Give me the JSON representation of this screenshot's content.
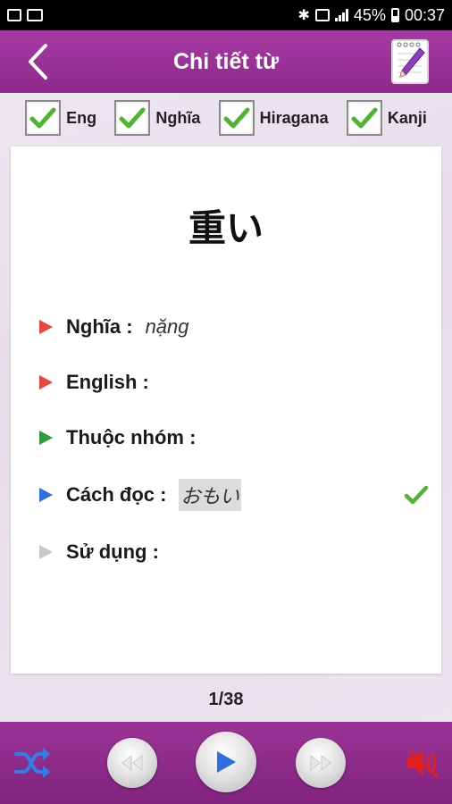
{
  "status_bar": {
    "battery": "45%",
    "time": "00:37",
    "icons": [
      "image-icon",
      "mail-icon",
      "bluetooth-icon",
      "nfc-icon",
      "signal-icon",
      "battery-icon"
    ]
  },
  "header": {
    "title": "Chi tiết từ",
    "back_icon": "back-chevron-icon",
    "notepad_icon": "notepad-pencil-icon",
    "background": "#9a3496"
  },
  "filters": [
    {
      "label": "Eng",
      "checked": true
    },
    {
      "label": "Nghĩa",
      "checked": true
    },
    {
      "label": "Hiragana",
      "checked": true
    },
    {
      "label": "Kanji",
      "checked": true
    }
  ],
  "card": {
    "word": "重い",
    "rows": [
      {
        "label": "Nghĩa :",
        "value": "nặng",
        "color": "#e8453c"
      },
      {
        "label": "English :",
        "value": "",
        "color": "#e8453c"
      },
      {
        "label": "Thuộc nhóm :",
        "value": "",
        "color": "#2e9b3a"
      },
      {
        "label": "Cách đọc :",
        "value": "おもい",
        "color": "#2f6fe0",
        "checked": true
      },
      {
        "label": "Sử dụng :",
        "value": "",
        "color": "#c8c8c8"
      }
    ]
  },
  "counter": "1/38",
  "controls": {
    "shuffle_icon": "shuffle-icon",
    "rewind_icon": "rewind-icon",
    "play_icon": "play-icon",
    "forward_icon": "fast-forward-icon",
    "mute_icon": "speaker-muted-icon",
    "accent": "#2f6fe0"
  }
}
